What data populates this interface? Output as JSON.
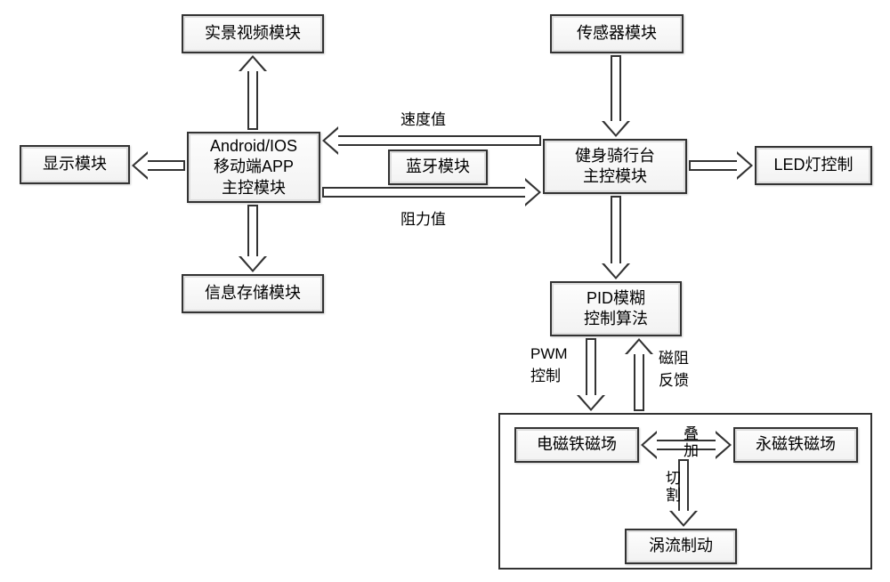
{
  "blocks": {
    "video": "实景视频模块",
    "sensor": "传感器模块",
    "display": "显示模块",
    "app_l1": "Android/IOS",
    "app_l2": "移动端APP",
    "app_l3": "主控模块",
    "bt": "蓝牙模块",
    "trainer_l1": "健身骑行台",
    "trainer_l2": "主控模块",
    "led": "LED灯控制",
    "storage": "信息存储模块",
    "pid_l1": "PID模糊",
    "pid_l2": "控制算法",
    "em": "电磁铁磁场",
    "pm": "永磁铁磁场",
    "eddy": "涡流制动"
  },
  "labels": {
    "speed": "速度值",
    "resist": "阻力值",
    "pwm_l1": "PWM",
    "pwm_l2": "控制",
    "mag_l1": "磁阻",
    "mag_l2": "反馈",
    "overlay": "叠加",
    "cut": "切割"
  }
}
